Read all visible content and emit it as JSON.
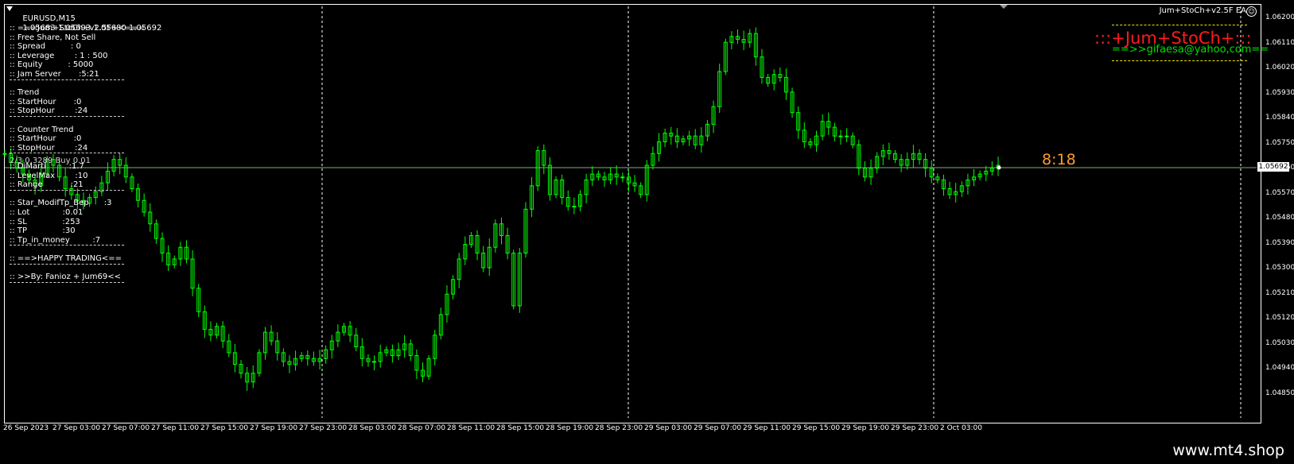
{
  "chart": {
    "symbol": "EURUSD,M15",
    "ohlc": "1.05683 1.05693 1.05680 1.05692",
    "current_price": "1.05692",
    "expert_name": "Jum+StoCh+v2.5F EA",
    "smiley_icon": "☺",
    "clock": "8:18",
    "ghost_text": "2/3 0.3289 Buy 0.01"
  },
  "brand": {
    "title": ":::+Jum+StoCh+:::",
    "email": "==>>gifaesa@yahoo,com=="
  },
  "info_panel": [
    ":: ===Jum+StoCh+v2.5F+<===",
    ":: Free Share, Not Sell",
    ":: Spread          : 0",
    ":: Leverage        : 1 : 500",
    ":: Equity          : 5000",
    ":: Jam Server       :5:21",
    "",
    ":: Trend",
    ":: StartHour       :0",
    ":: StopHour        :24",
    "",
    ":: Counter Trend",
    ":: StartHour       :0",
    ":: StopHour        :24",
    "",
    ":: DiMarti         :1.7",
    ":: LevelMax        :10",
    ":: Range           :21",
    "",
    ":: Star_ModifTp_Bep      :3",
    ":: Lot             :0.01",
    ":: SL              :253",
    ":: TP              :30",
    ":: Tp_in_money         :7",
    "",
    ":: ==>HAPPY TRADING<==",
    "",
    ":: >>By: Fanioz + Jum69<<"
  ],
  "y_axis": [
    "1.06200",
    "1.06110",
    "1.06020",
    "1.05930",
    "1.05840",
    "1.05750",
    "1.05660",
    "1.05570",
    "1.05480",
    "1.05390",
    "1.05300",
    "1.05210",
    "1.05120",
    "1.05030",
    "1.04940",
    "1.04850"
  ],
  "x_axis": [
    "26 Sep 2023",
    "27 Sep 03:00",
    "27 Sep 07:00",
    "27 Sep 11:00",
    "27 Sep 15:00",
    "27 Sep 19:00",
    "27 Sep 23:00",
    "28 Sep 03:00",
    "28 Sep 07:00",
    "28 Sep 11:00",
    "28 Sep 15:00",
    "28 Sep 19:00",
    "28 Sep 23:00",
    "29 Sep 03:00",
    "29 Sep 07:00",
    "29 Sep 11:00",
    "29 Sep 15:00",
    "29 Sep 19:00",
    "29 Sep 23:00",
    "2 Oct 03:00"
  ],
  "colors": {
    "candle": "#00ff00",
    "bid_line": "#7fb07f",
    "brand_red": "#ff1a1a",
    "brand_green": "#00e000",
    "clock": "#ff9c2a"
  },
  "footer": {
    "site": "www.mt4.shop"
  },
  "chart_data": {
    "type": "line",
    "series": [
      {
        "name": "",
        "values": [
          1.0574,
          1.0571,
          1.0569,
          1.0567,
          1.0565,
          1.0563,
          1.0567,
          1.0572,
          1.057,
          1.0566,
          1.0562,
          1.056,
          1.0558,
          1.0557,
          1.0559,
          1.0561,
          1.0564,
          1.0568,
          1.0572,
          1.057,
          1.0566,
          1.0562,
          1.0558,
          1.0554,
          1.055,
          1.0545,
          1.054,
          1.0536,
          1.0538,
          1.0542,
          1.0538,
          1.0528,
          1.052,
          1.0514,
          1.0512,
          1.0515,
          1.051,
          1.0506,
          1.0502,
          1.0499,
          1.0496,
          1.0499,
          1.0506,
          1.0513,
          1.051,
          1.0506,
          1.0503,
          1.0502,
          1.0504,
          1.0505,
          1.0504,
          1.0503,
          1.0504,
          1.0507,
          1.051,
          1.0513,
          1.0515,
          1.0512,
          1.0508,
          1.0504,
          1.0503,
          1.0503,
          1.0506,
          1.0507,
          1.0505,
          1.0507,
          1.0509,
          1.0505,
          1.05,
          1.0498,
          1.0504,
          1.0512,
          1.0519,
          1.0526,
          1.0531,
          1.0538,
          1.0543,
          1.0546,
          1.054,
          1.0535,
          1.0542,
          1.055,
          1.0546,
          1.054,
          1.0522,
          1.054,
          1.0555,
          1.0563,
          1.0575,
          1.057,
          1.056,
          1.0565,
          1.0559,
          1.0556,
          1.0556,
          1.056,
          1.0565,
          1.0567,
          1.0566,
          1.0565,
          1.0567,
          1.0566,
          1.0566,
          1.0564,
          1.0563,
          1.056,
          1.057,
          1.0574,
          1.0578,
          1.0581,
          1.058,
          1.0578,
          1.0579,
          1.058,
          1.0577,
          1.058,
          1.0584,
          1.059,
          1.0602,
          1.0612,
          1.0614,
          1.0613,
          1.0612,
          1.0615,
          1.0607,
          1.06,
          1.0598,
          1.0601,
          1.06,
          1.0595,
          1.0588,
          1.0582,
          1.0578,
          1.0577,
          1.058,
          1.0585,
          1.0583,
          1.058,
          1.058,
          1.058,
          1.0577,
          1.0569,
          1.0566,
          1.0569,
          1.0573,
          1.0575,
          1.0574,
          1.0572,
          1.057,
          1.0572,
          1.0574,
          1.0572,
          1.0569,
          1.0566,
          1.0565,
          1.0562,
          1.056,
          1.0561,
          1.0563,
          1.0565,
          1.0566,
          1.0567,
          1.0568,
          1.0569,
          1.057
        ],
        "color": "#00ff00"
      }
    ],
    "ylim": [
      1.0484,
      1.0624
    ],
    "grid": false
  }
}
